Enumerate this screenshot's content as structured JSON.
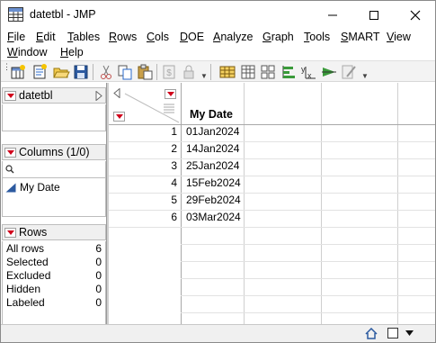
{
  "window": {
    "title": "datetbl - JMP"
  },
  "menu": [
    "File",
    "Edit",
    "Tables",
    "Rows",
    "Cols",
    "DOE",
    "Analyze",
    "Graph",
    "Tools",
    "SMART",
    "View",
    "Window",
    "Help"
  ],
  "table_panel": {
    "title": "datetbl"
  },
  "columns_panel": {
    "title": "Columns (1/0)",
    "search_placeholder": "",
    "items": [
      "My Date"
    ]
  },
  "rows_panel": {
    "title": "Rows",
    "stats": [
      {
        "label": "All rows",
        "value": "6"
      },
      {
        "label": "Selected",
        "value": "0"
      },
      {
        "label": "Excluded",
        "value": "0"
      },
      {
        "label": "Hidden",
        "value": "0"
      },
      {
        "label": "Labeled",
        "value": "0"
      }
    ]
  },
  "grid": {
    "column_header": "My Date",
    "rows": [
      {
        "num": "1",
        "value": "01Jan2024"
      },
      {
        "num": "2",
        "value": "14Jan2024"
      },
      {
        "num": "3",
        "value": "25Jan2024"
      },
      {
        "num": "4",
        "value": "15Feb2024"
      },
      {
        "num": "5",
        "value": "29Feb2024"
      },
      {
        "num": "6",
        "value": "03Mar2024"
      }
    ]
  },
  "colors": {
    "accent_red": "#d0021b",
    "panel_bg": "#f0f0f0",
    "grid_line": "#cfcfcf"
  }
}
